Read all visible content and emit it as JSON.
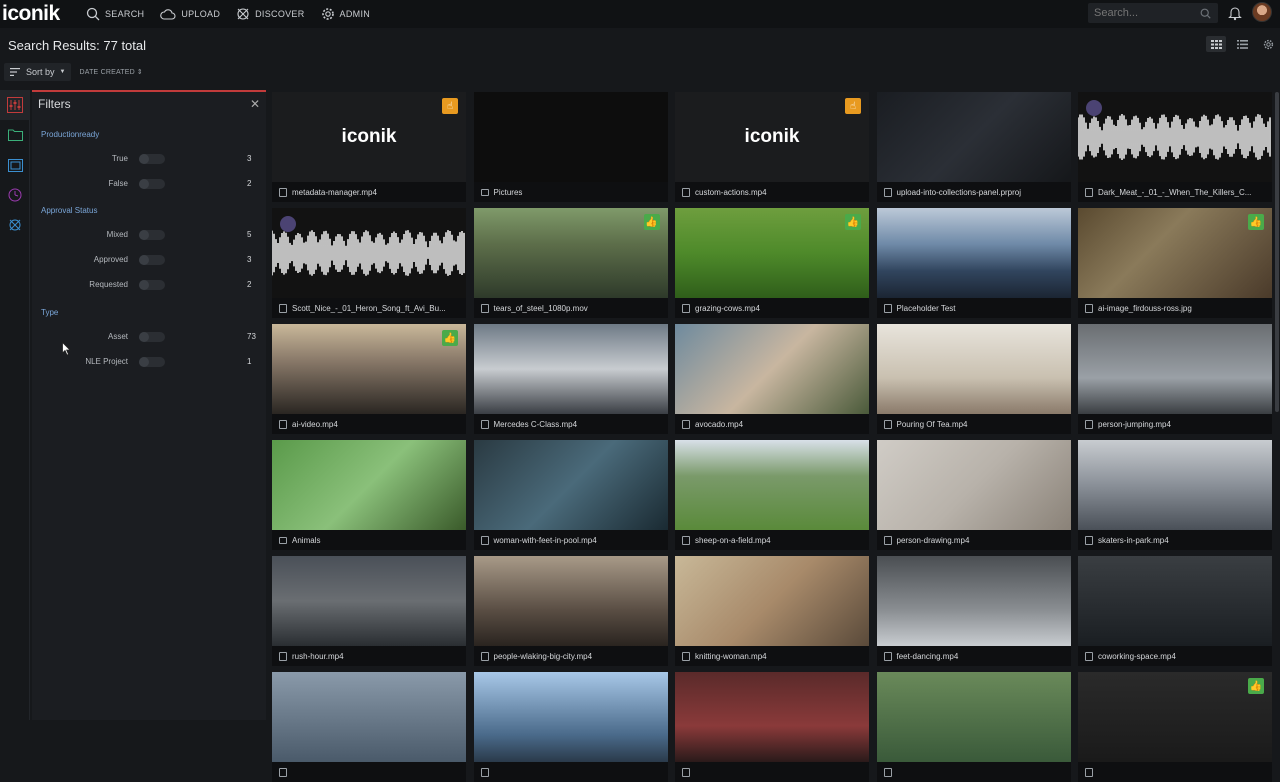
{
  "app": {
    "logo": "iconik"
  },
  "nav": [
    {
      "label": "SEARCH",
      "icon": "search-icon"
    },
    {
      "label": "UPLOAD",
      "icon": "cloud-upload-icon"
    },
    {
      "label": "DISCOVER",
      "icon": "discover-icon"
    },
    {
      "label": "ADMIN",
      "icon": "gear-icon"
    }
  ],
  "search": {
    "placeholder": "Search..."
  },
  "results": {
    "title": "Search Results: 77 total"
  },
  "sort": {
    "label": "Sort by",
    "field": "DATE CREATED"
  },
  "filters": {
    "title": "Filters",
    "close": "✕",
    "groups": [
      {
        "title": "Productionready",
        "rows": [
          {
            "label": "True",
            "count": "3"
          },
          {
            "label": "False",
            "count": "2"
          }
        ]
      },
      {
        "title": "Approval Status",
        "rows": [
          {
            "label": "Mixed",
            "count": "5"
          },
          {
            "label": "Approved",
            "count": "3"
          },
          {
            "label": "Requested",
            "count": "2"
          }
        ]
      },
      {
        "title": "Type",
        "rows": [
          {
            "label": "Asset",
            "count": "73"
          },
          {
            "label": "NLE Project",
            "count": "1"
          }
        ]
      }
    ]
  },
  "tiles": [
    {
      "name": "metadata-manager.mp4",
      "kind": "video",
      "badge": "orange"
    },
    {
      "name": "Pictures",
      "kind": "folder"
    },
    {
      "name": "custom-actions.mp4",
      "kind": "video",
      "badge": "orange"
    },
    {
      "name": "upload-into-collections-panel.prproj",
      "kind": "project"
    },
    {
      "name": "Dark_Meat_-_01_-_When_The_Killers_C...",
      "kind": "audio"
    },
    {
      "name": "Scott_Nice_-_01_Heron_Song_ft_Avi_Bu...",
      "kind": "audio"
    },
    {
      "name": "tears_of_steel_1080p.mov",
      "kind": "video",
      "badge": "green"
    },
    {
      "name": "grazing-cows.mp4",
      "kind": "video",
      "badge": "green"
    },
    {
      "name": "Placeholder Test",
      "kind": "video"
    },
    {
      "name": "ai-image_firdouss-ross.jpg",
      "kind": "image",
      "badge": "green"
    },
    {
      "name": "ai-video.mp4",
      "kind": "video",
      "badge": "green"
    },
    {
      "name": "Mercedes C-Class.mp4",
      "kind": "video"
    },
    {
      "name": "avocado.mp4",
      "kind": "video"
    },
    {
      "name": "Pouring Of Tea.mp4",
      "kind": "video"
    },
    {
      "name": "person-jumping.mp4",
      "kind": "video"
    },
    {
      "name": "Animals",
      "kind": "folder"
    },
    {
      "name": "woman-with-feet-in-pool.mp4",
      "kind": "video"
    },
    {
      "name": "sheep-on-a-field.mp4",
      "kind": "video"
    },
    {
      "name": "person-drawing.mp4",
      "kind": "video"
    },
    {
      "name": "skaters-in-park.mp4",
      "kind": "video"
    },
    {
      "name": "rush-hour.mp4",
      "kind": "video"
    },
    {
      "name": "people-wlaking-big-city.mp4",
      "kind": "video"
    },
    {
      "name": "knitting-woman.mp4",
      "kind": "video"
    },
    {
      "name": "feet-dancing.mp4",
      "kind": "video"
    },
    {
      "name": "coworking-space.mp4",
      "kind": "video"
    },
    {
      "name": "",
      "kind": "video"
    },
    {
      "name": "",
      "kind": "video"
    },
    {
      "name": "",
      "kind": "video"
    },
    {
      "name": "",
      "kind": "video"
    },
    {
      "name": "",
      "kind": "video",
      "badge": "green"
    }
  ],
  "colors": {
    "accent": "#c23b3b",
    "link": "#7aa6d8",
    "badge_orange": "#e89a20",
    "badge_green": "#4aaa4a"
  }
}
